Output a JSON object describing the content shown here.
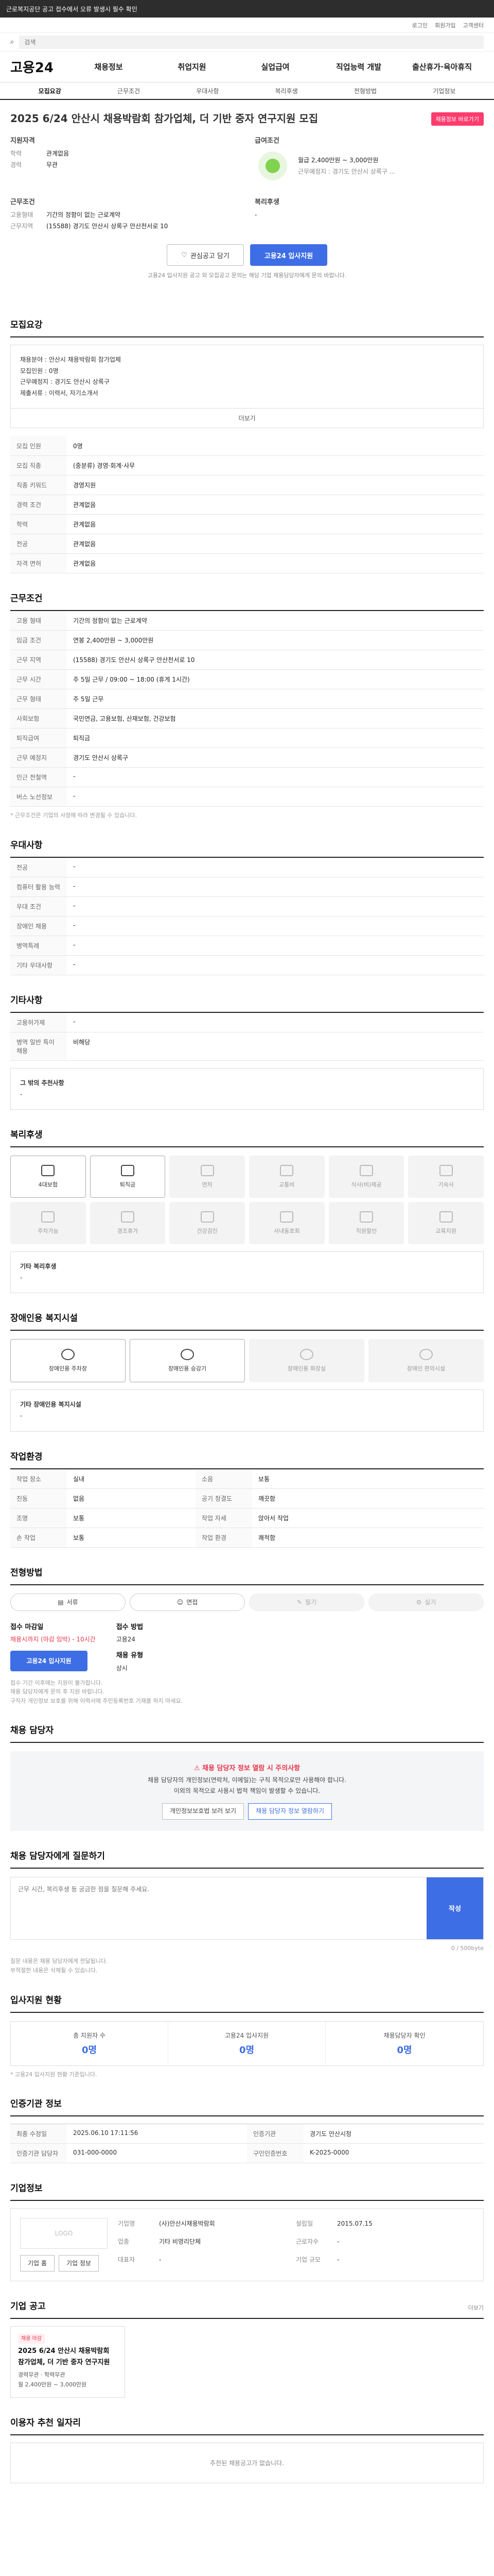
{
  "topbar": {
    "text": "근로복지공단 공고 접수에서 오류 발생시 필수 확인"
  },
  "util": [
    "로그인",
    "회원가입",
    "고객센터"
  ],
  "search": {
    "placeholder": "검색"
  },
  "gnb": {
    "logo": "고용24",
    "items": [
      "채용정보",
      "취업지원",
      "실업급여",
      "직업능력 개발",
      "출산휴가·육아휴직"
    ]
  },
  "tabs": [
    "모집요강",
    "근무조건",
    "우대사항",
    "복리후생",
    "전형방법",
    "기업정보"
  ],
  "job": {
    "title": "2025 6/24 안산시 채용박람회 참가업체, 더 기반 중자 연구지원 모집",
    "cta": "채용정보 바로가기",
    "sub1": "지원자격",
    "edu_k": "학력",
    "edu": "관계없음",
    "career_k": "경력",
    "career": "무관",
    "sub2": "근무조건",
    "type_k": "고용형태",
    "type": "기간의 정함이 없는 근로계약",
    "loc_k": "근무지역",
    "loc": "(15588) 경기도 안산시 상록구 안산천서로 10",
    "sub3": "급여조건",
    "pay": "월급 2,400만원 ~ 3,000만원",
    "pay_note": "근무예정지 : 경기도 안산시 상록구 ...",
    "sub4": "복리후생",
    "welfare": "-",
    "btn_save": "관심공고 담기",
    "btn_apply": "고용24 입사지원",
    "notice": "고용24 입사지원 공고 외 모집공고 문의는 해당 기업 채용담당자에게 문의 바랍니다."
  },
  "recruit": {
    "title": "모집요강",
    "body": [
      "채용분야 : 안산시 채용박람회 참가업체",
      "모집인원 : 0명",
      "근무예정지 : 경기도 안산시 상록구",
      "제출서류 : 이력서, 자기소개서"
    ],
    "more": "더보기",
    "rows": [
      [
        "모집 인원",
        "0명"
      ],
      [
        "모집 직종",
        "(중분류) 경영·회계·사무"
      ],
      [
        "직종 키워드",
        "경영지원"
      ],
      [
        "경력 조건",
        "관계없음"
      ],
      [
        "학력",
        "관계없음"
      ],
      [
        "전공",
        "관계없음"
      ],
      [
        "자격 면허",
        "관계없음"
      ]
    ]
  },
  "cond": {
    "title": "근무조건",
    "rows": [
      [
        "고용 형태",
        "기간의 정함이 없는 근로계약"
      ],
      [
        "임금 조건",
        "연봉 2,400만원 ~ 3,000만원"
      ],
      [
        "근무 지역",
        "(15588) 경기도 안산시 상록구 안산천서로 10"
      ],
      [
        "근무 시간",
        "주 5일 근무 / 09:00 ~ 18:00 (휴게 1시간)"
      ],
      [
        "근무 형태",
        "주 5일 근무"
      ],
      [
        "사회보험",
        "국민연금, 고용보험, 산재보험, 건강보험"
      ],
      [
        "퇴직급여",
        "퇴직금"
      ],
      [
        "근무 예정지",
        "경기도 안산시 상록구"
      ],
      [
        "인근 전철역",
        "-"
      ],
      [
        "버스 노선정보",
        "-"
      ]
    ],
    "foot": "* 근무조건은 기업의 사정에 따라 변경될 수 있습니다."
  },
  "pref": {
    "title": "우대사항",
    "rows": [
      [
        "전공",
        "-"
      ],
      [
        "컴퓨터 활용 능력",
        "-"
      ],
      [
        "우대 조건",
        "-"
      ],
      [
        "장애인 채용",
        "-"
      ],
      [
        "병역특례",
        "-"
      ],
      [
        "기타 우대사항",
        "-"
      ]
    ]
  },
  "etc": {
    "title": "기타사항",
    "rows": [
      [
        "고용허가제",
        "-"
      ],
      [
        "병역 일반 특이 채용",
        "비해당"
      ]
    ],
    "label": "그 밖의 추천사항",
    "value": "-"
  },
  "welfare": {
    "title": "복리후생",
    "items": [
      "4대보험",
      "퇴직금",
      "연차",
      "교통비",
      "식사(비)제공",
      "기숙사",
      "주차가능",
      "경조휴가",
      "건강검진",
      "사내동호회",
      "직원할인",
      "교육지원"
    ],
    "active": [
      0,
      1
    ],
    "other_label": "기타 복리후생",
    "other": "-"
  },
  "disabled": {
    "title": "장애인용 복지시설",
    "items": [
      "장애인용 주차장",
      "장애인용 승강기",
      "장애인용 화장실",
      "장애인 편의시설"
    ],
    "active": [
      0,
      1
    ],
    "other_label": "기타 장애인용 복지시설",
    "other": "-"
  },
  "work": {
    "title": "작업환경",
    "rows": [
      [
        "작업 장소",
        "실내"
      ],
      [
        "소음",
        "보통"
      ],
      [
        "진동",
        "없음"
      ],
      [
        "공기 청결도",
        "깨끗함"
      ],
      [
        "조명",
        "보통"
      ],
      [
        "작업 자세",
        "앉아서 작업"
      ],
      [
        "손 작업",
        "보통"
      ],
      [
        "작업 환경",
        "쾌적함"
      ]
    ]
  },
  "method": {
    "title": "전형방법",
    "steps": [
      "서류",
      "면접",
      "필기",
      "실기"
    ],
    "active": [
      0,
      1
    ],
    "apply_k": "접수 마감일",
    "apply_v": "채용시까지 (마감 임박)",
    "red": "- 10시간",
    "way_k": "접수 방법",
    "way_v": "고용24",
    "type_k": "채용 유형",
    "type_v": "상시",
    "btn": "고용24 입사지원",
    "notes": [
      "접수 기간 이후에는 지원이 불가합니다.",
      "채용 담당자에게 문의 후 지원 바랍니다.",
      "구직자 개인정보 보호를 위해 이력서에 주민등록번호 기재를 하지 마세요."
    ]
  },
  "contact": {
    "title": "채용 담당자",
    "warn": "채용 담당자 정보 열람 시 주의사항",
    "lines": [
      "채용 담당자의 개인정보(연락처, 이메일)는 구직 목적으로만 사용해야 합니다.",
      "이외의 목적으로 사용시 법적 책임이 발생할 수 있습니다."
    ],
    "b1": "개인정보보호법 보러 보기",
    "b2": "채용 담당자 정보 열람하기"
  },
  "qa": {
    "title": "채용 담당자에게 질문하기",
    "placeholder": "근무 시간, 복리후생 등 궁금한 점을 질문해 주세요.",
    "count": "0 / 500byte",
    "send": "작성",
    "notes": [
      "질문 내용은 채용 담당자에게 전달됩니다.",
      "부적절한 내용은 삭제될 수 있습니다."
    ]
  },
  "stat": {
    "title": "입사지원 현황",
    "items": [
      [
        "총 지원자 수",
        "0명"
      ],
      [
        "고용24 입사지원",
        "0명"
      ],
      [
        "채용담당자 확인",
        "0명"
      ]
    ],
    "note": "* 고용24 입사지원 현황 기준입니다."
  },
  "regist": {
    "title": "인증기관 정보",
    "rows": [
      [
        "최종 수정일",
        "2025.06.10 17:11:56"
      ],
      [
        "인증기관",
        "경기도 안산시청"
      ],
      [
        "인증기관 담당자",
        "031-000-0000"
      ],
      [
        "구인인증번호",
        "K-2025-0000"
      ]
    ]
  },
  "corp": {
    "title": "기업정보",
    "logo": "LOGO",
    "btn1": "기업 홈",
    "btn2": "기업 정보",
    "rows": [
      [
        "기업명",
        "(사)안산시채용박람회"
      ],
      [
        "업종",
        "기타 비영리단체"
      ],
      [
        "대표자",
        "-"
      ],
      [
        "설립일",
        "2015.07.15"
      ],
      [
        "근로자수",
        "-"
      ],
      [
        "기업 규모",
        "-"
      ]
    ]
  },
  "similar": {
    "title": "기업 공고",
    "more": "더보기",
    "cards": [
      {
        "badge": "채용 마감",
        "t": "2025 6/24 안산시 채용박람회 참가업체, 더 기반 중자 연구지원",
        "d": "경력무관 · 학력무관",
        "p": "월 2,400만원 ~ 3,000만원"
      }
    ]
  },
  "rec": {
    "title": "이용자 추천 일자리",
    "empty": "추천된 채용공고가 없습니다."
  }
}
